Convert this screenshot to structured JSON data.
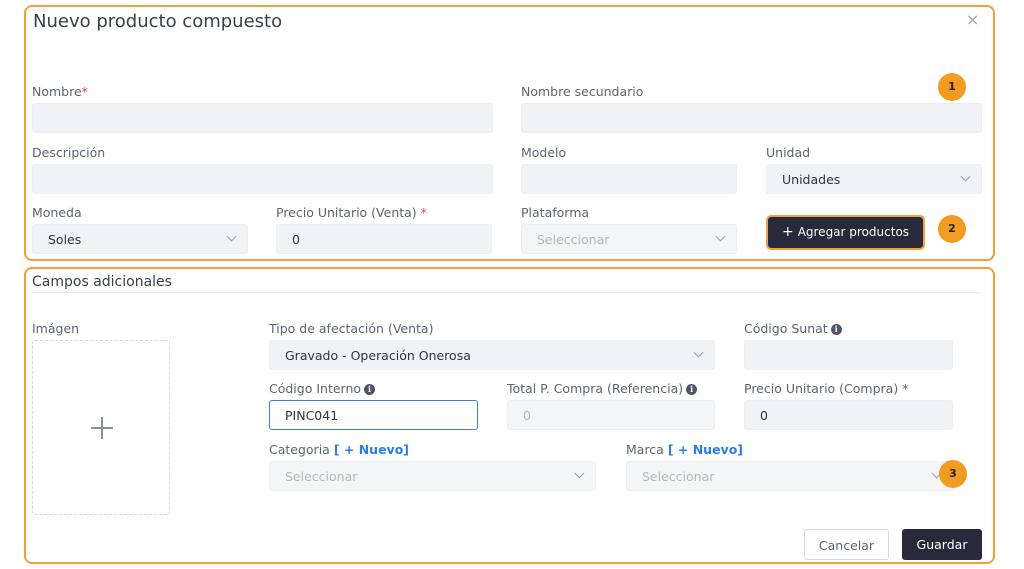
{
  "dialog": {
    "title": "Nuevo producto compuesto",
    "close_symbol": "×"
  },
  "badges": [
    "1",
    "2",
    "3"
  ],
  "form": {
    "nombre_label": "Nombre",
    "required_mark": "*",
    "nombre_secundario_label": "Nombre secundario",
    "descripcion_label": "Descripción",
    "modelo_label": "Modelo",
    "unidad_label": "Unidad",
    "unidad_value": "Unidades",
    "moneda_label": "Moneda",
    "moneda_value": "Soles",
    "precio_venta_label": "Precio Unitario (Venta)",
    "precio_venta_value": "0",
    "plataforma_label": "Plataforma",
    "plataforma_placeholder": "Seleccionar",
    "add_products_label": "Agregar productos",
    "add_products_symbol": "+"
  },
  "additional": {
    "section_title": "Campos adicionales",
    "imagen_label": "Imágen",
    "tipo_afectacion_label": "Tipo de afectación (Venta)",
    "tipo_afectacion_value": "Gravado - Operación Onerosa",
    "codigo_sunat_label": "Código Sunat",
    "codigo_interno_label": "Código Interno",
    "codigo_interno_value": "PINC041",
    "total_compra_label": "Total P. Compra (Referencia)",
    "total_compra_value": "0",
    "precio_compra_label": "Precio Unitario (Compra) *",
    "precio_compra_value": "0",
    "categoria_label": "Categoria",
    "categoria_new": "[ + Nuevo]",
    "categoria_placeholder": "Seleccionar",
    "marca_label": "Marca",
    "marca_new": "[ + Nuevo]",
    "marca_placeholder": "Seleccionar",
    "info_symbol": "i"
  },
  "actions": {
    "cancel_label": "Cancelar",
    "save_label": "Guardar"
  },
  "colors": {
    "highlight": "#f0a03c",
    "badge": "#f29c22",
    "dark_button": "#262a3b",
    "link": "#2a7de1",
    "required": "#e04848"
  }
}
